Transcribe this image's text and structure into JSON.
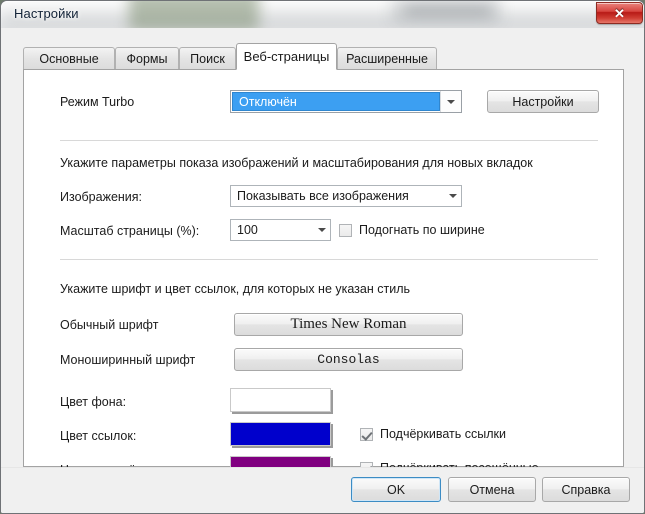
{
  "window": {
    "title": "Настройки",
    "close_label": "✕"
  },
  "tabs": [
    {
      "label": "Основные",
      "active": false
    },
    {
      "label": "Формы",
      "active": false
    },
    {
      "label": "Поиск",
      "active": false
    },
    {
      "label": "Веб-страницы",
      "active": true
    },
    {
      "label": "Расширенные",
      "active": false
    }
  ],
  "turbo": {
    "label": "Режим Turbo",
    "value": "Отключён",
    "settings_button": "Настройки"
  },
  "images_section": {
    "note": "Укажите параметры показа изображений и масштабирования для новых вкладок",
    "images_label": "Изображения:",
    "images_value": "Показывать все изображения",
    "scale_label": "Масштаб страницы (%):",
    "scale_value": "100",
    "fit_width_label": "Подогнать по ширине",
    "fit_width_checked": false
  },
  "fonts_section": {
    "note": "Укажите шрифт и цвет ссылок, для которых не указан стиль",
    "normal_font_label": "Обычный шрифт",
    "normal_font_value": "Times New Roman",
    "mono_font_label": "Моноширинный шрифт",
    "mono_font_value": "Consolas"
  },
  "colors_section": {
    "background_label": "Цвет фона:",
    "background_color": "#ffffff",
    "link_label": "Цвет ссылок:",
    "link_color": "#0000cc",
    "visited_label": "Цвет посещённых ссылок:",
    "visited_color": "#800080",
    "underline_links_label": "Подчёркивать ссылки",
    "underline_links_checked": true,
    "underline_visited_label": "Подчёркивать посещённые",
    "underline_visited_checked": true
  },
  "footer": {
    "ok": "OK",
    "cancel": "Отмена",
    "help": "Справка"
  }
}
